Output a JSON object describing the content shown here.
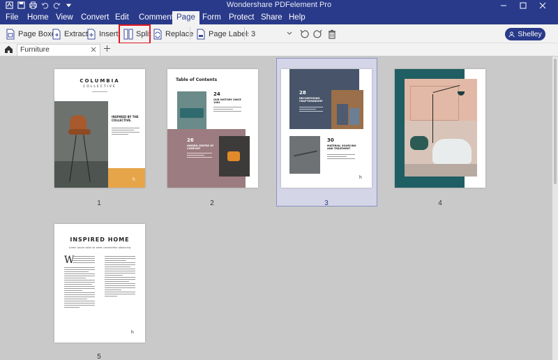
{
  "title_bar": {
    "title": "Wondershare PDFelement Pro",
    "quick_access": [
      "logo-icon",
      "save-icon",
      "print-icon",
      "undo-icon",
      "redo-icon",
      "customize-icon"
    ],
    "window_controls": [
      "minimize-icon",
      "maximize-icon",
      "close-icon"
    ]
  },
  "menu": {
    "items": [
      "File",
      "Home",
      "View",
      "Convert",
      "Edit",
      "Comment",
      "Page",
      "Form",
      "Protect",
      "Share",
      "Help"
    ],
    "active": "Page"
  },
  "toolbar": {
    "page_boxes": "Page Boxes",
    "extract": "Extract",
    "insert": "Insert",
    "split": "Split",
    "replace": "Replace",
    "page_labels": "Page Labels",
    "page_value": "3",
    "rotate_left_icon": "rotate-left-icon",
    "rotate_right_icon": "rotate-right-icon",
    "delete_icon": "trash-icon",
    "user": "Shelley"
  },
  "tabs": {
    "document": "Furniture"
  },
  "colors": {
    "brand": "#2a3a8a",
    "highlight": "#e0171f",
    "selected_page_bg": "#d4d5e6",
    "canvas": "#c9c9c9"
  },
  "pages": [
    {
      "number": "1",
      "brand": "COLUMBIA",
      "brand_sub": "COLLECTIVE",
      "tagline": "INSPIRED BY THE COLLECTIVE."
    },
    {
      "number": "2",
      "heading": "Table of Contents",
      "item1_num": "24",
      "item1_title": "OUR HISTORY SINCE 1981",
      "item2_num": "26",
      "item2_title": "HIDDEN CENTRE OF COMFORT"
    },
    {
      "number": "3",
      "item1_num": "28",
      "item1_title": "DECOMPOSING CRAFTSMANSHIP",
      "item2_num": "30",
      "item2_title": "MATERIAL SOURCING AND TREATMENT"
    },
    {
      "number": "4"
    },
    {
      "number": "5",
      "heading": "INSPIRED HOME",
      "subheading": "Lorem ipsum dolor sit amet consectetur adipiscing"
    }
  ]
}
